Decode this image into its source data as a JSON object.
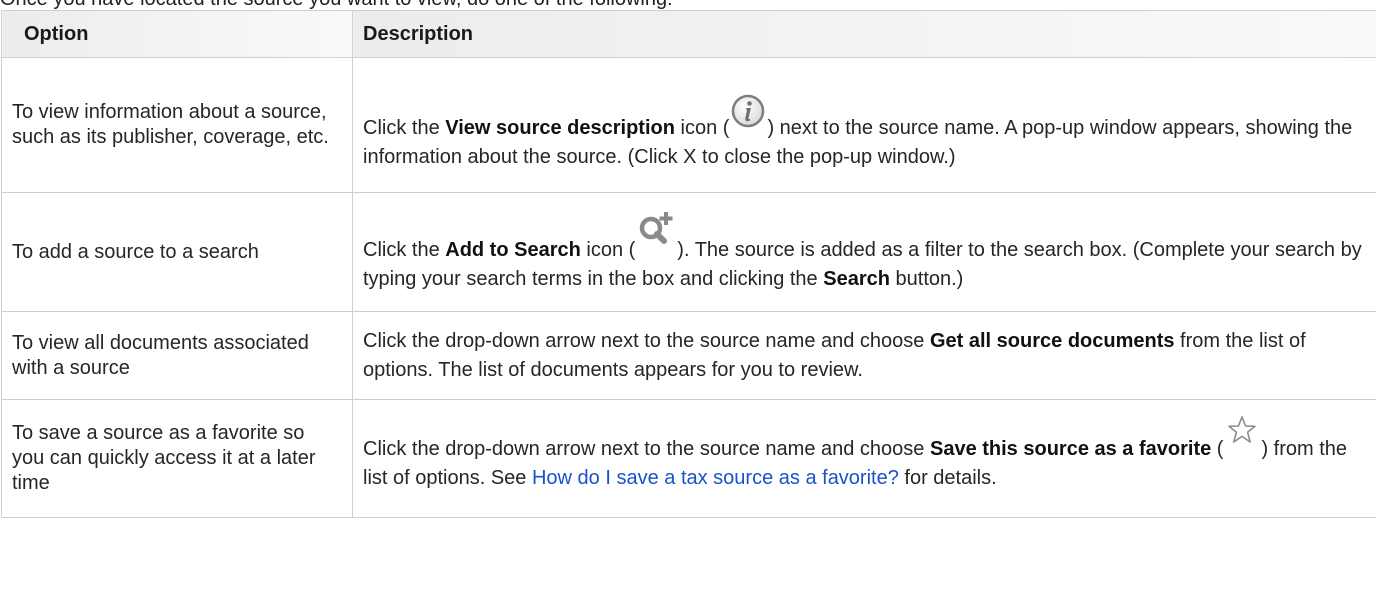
{
  "intro": "Once you have located the source you want to view, do one of the following:",
  "table": {
    "headers": [
      "Option",
      "Description"
    ],
    "rows": [
      {
        "option": "To view information about a source, such as its publisher, coverage, etc.",
        "desc": {
          "t1": "Click the ",
          "b1": "View source description",
          "t2": " icon (",
          "icon": "info-icon",
          "t3": ") next to the source name. A pop-up window appears, showing the information about the source. (Click X to close the pop-up window.)"
        }
      },
      {
        "option": "To add a source to a search",
        "desc": {
          "t1": "Click the ",
          "b1": "Add to Search",
          "t2": " icon (",
          "icon": "add-to-search-icon",
          "t3": "). The source is added as a filter to the search box. (Complete your search by typing your search terms in the box and clicking the ",
          "b2": "Search",
          "t4": " button.)"
        }
      },
      {
        "option": "To view all documents associated with a source",
        "desc": {
          "t1": "Click the drop-down arrow next to the source name and choose ",
          "b1": "Get all source documents",
          "t2": " from the list of options. The list of documents appears for you to review."
        }
      },
      {
        "option": "To save a source as a favorite so you can quickly access it at a later time",
        "desc": {
          "t1": "Click the drop-down arrow next to the source name and choose ",
          "b1": "Save this source as a favorite",
          "t2": " (",
          "icon": "star-icon",
          "t3": ") from the list of options. See ",
          "link": "How do I save a tax source as a favorite?",
          "t4": " for details."
        }
      }
    ]
  }
}
